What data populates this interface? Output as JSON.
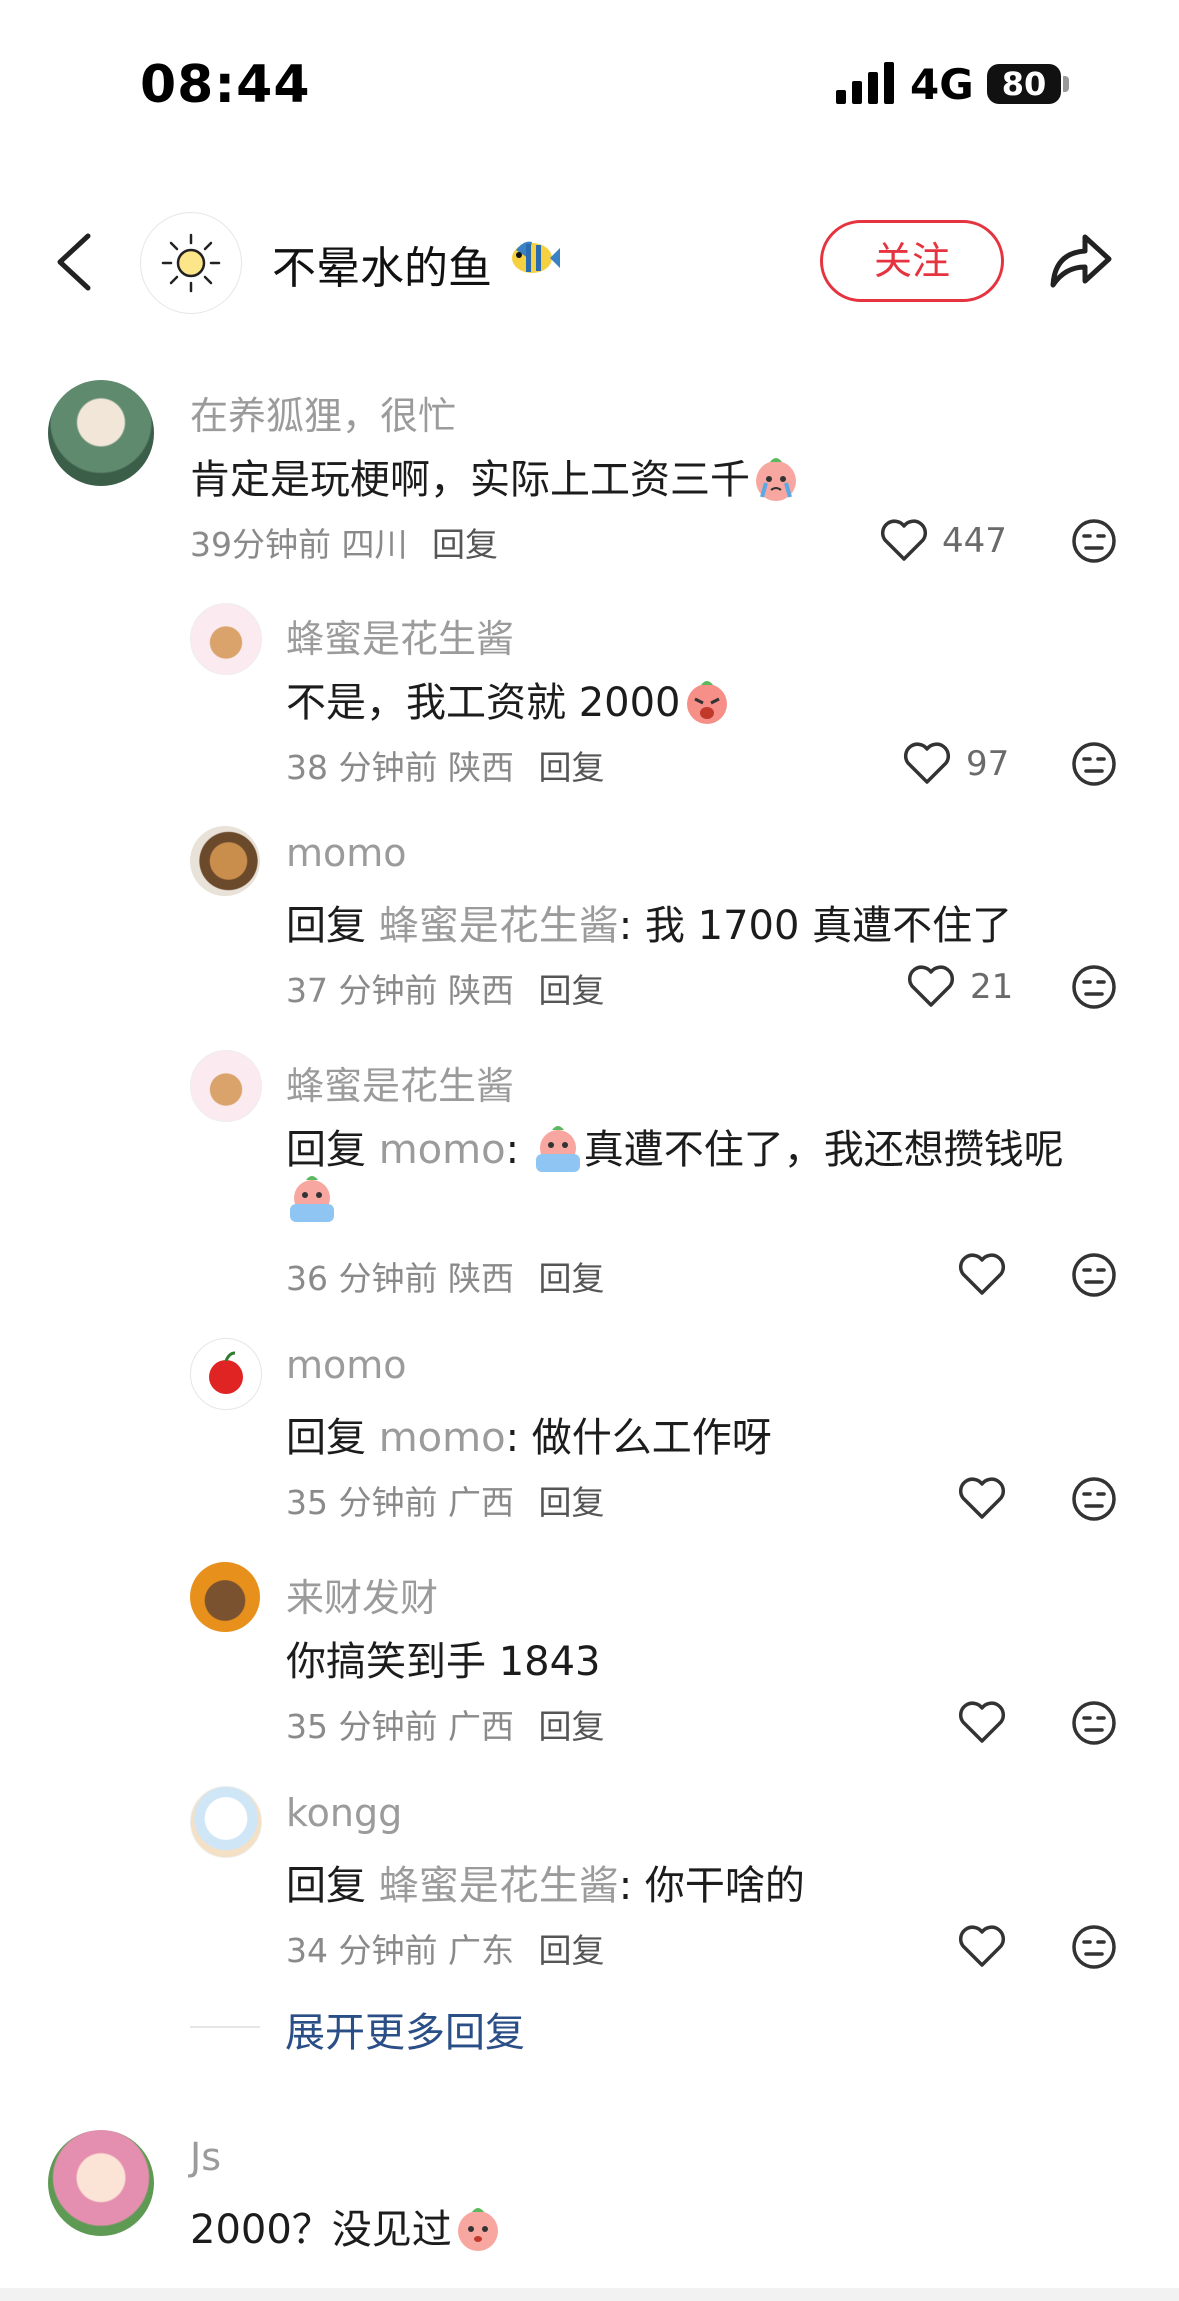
{
  "status_bar": {
    "time": "08:44",
    "network": "4G",
    "battery": "80"
  },
  "header": {
    "title": "不晕水的鱼",
    "follow_label": "关注"
  },
  "comments": [
    {
      "name": "在养狐狸，很忙",
      "text": "肯定是玩梗啊，实际上工资三千",
      "time": "39分钟前",
      "location": "四川",
      "reply_label": "回复",
      "likes": "447"
    },
    {
      "name": "蜂蜜是花生酱",
      "text": "不是，我工资就 2000",
      "time": "38 分钟前",
      "location": "陕西",
      "reply_label": "回复",
      "likes": "97"
    },
    {
      "name": "momo",
      "prefix": "回复",
      "ref": "蜂蜜是花生酱",
      "text": ": 我 1700 真遭不住了",
      "time": "37 分钟前",
      "location": "陕西",
      "reply_label": "回复",
      "likes": "21"
    },
    {
      "name": "蜂蜜是花生酱",
      "prefix": "回复",
      "ref": "momo",
      "text": ": ",
      "text2": "真遭不住了，我还想攒钱呢",
      "time": "36 分钟前",
      "location": "陕西",
      "reply_label": "回复"
    },
    {
      "name": "momo",
      "prefix": "回复",
      "ref": "momo",
      "text": ": 做什么工作呀",
      "time": "35 分钟前",
      "location": "广西",
      "reply_label": "回复"
    },
    {
      "name": "来财发财",
      "text": "你搞笑到手 1843",
      "time": "35 分钟前",
      "location": "广西",
      "reply_label": "回复"
    },
    {
      "name": "kongg",
      "prefix": "回复",
      "ref": "蜂蜜是花生酱",
      "text": ": 你干啥的",
      "time": "34 分钟前",
      "location": "广东",
      "reply_label": "回复"
    },
    {
      "name": "Js",
      "text": "2000？没见过"
    }
  ],
  "expand_label": "展开更多回复",
  "colors": {
    "accent": "#e5343f",
    "link": "#2a4e86",
    "muted": "#9b9b9b"
  },
  "icons": [
    "back-icon",
    "sun-icon",
    "fish-emoji",
    "share-icon",
    "heart-icon",
    "dislike-face-icon",
    "crying-peach-emoji"
  ]
}
